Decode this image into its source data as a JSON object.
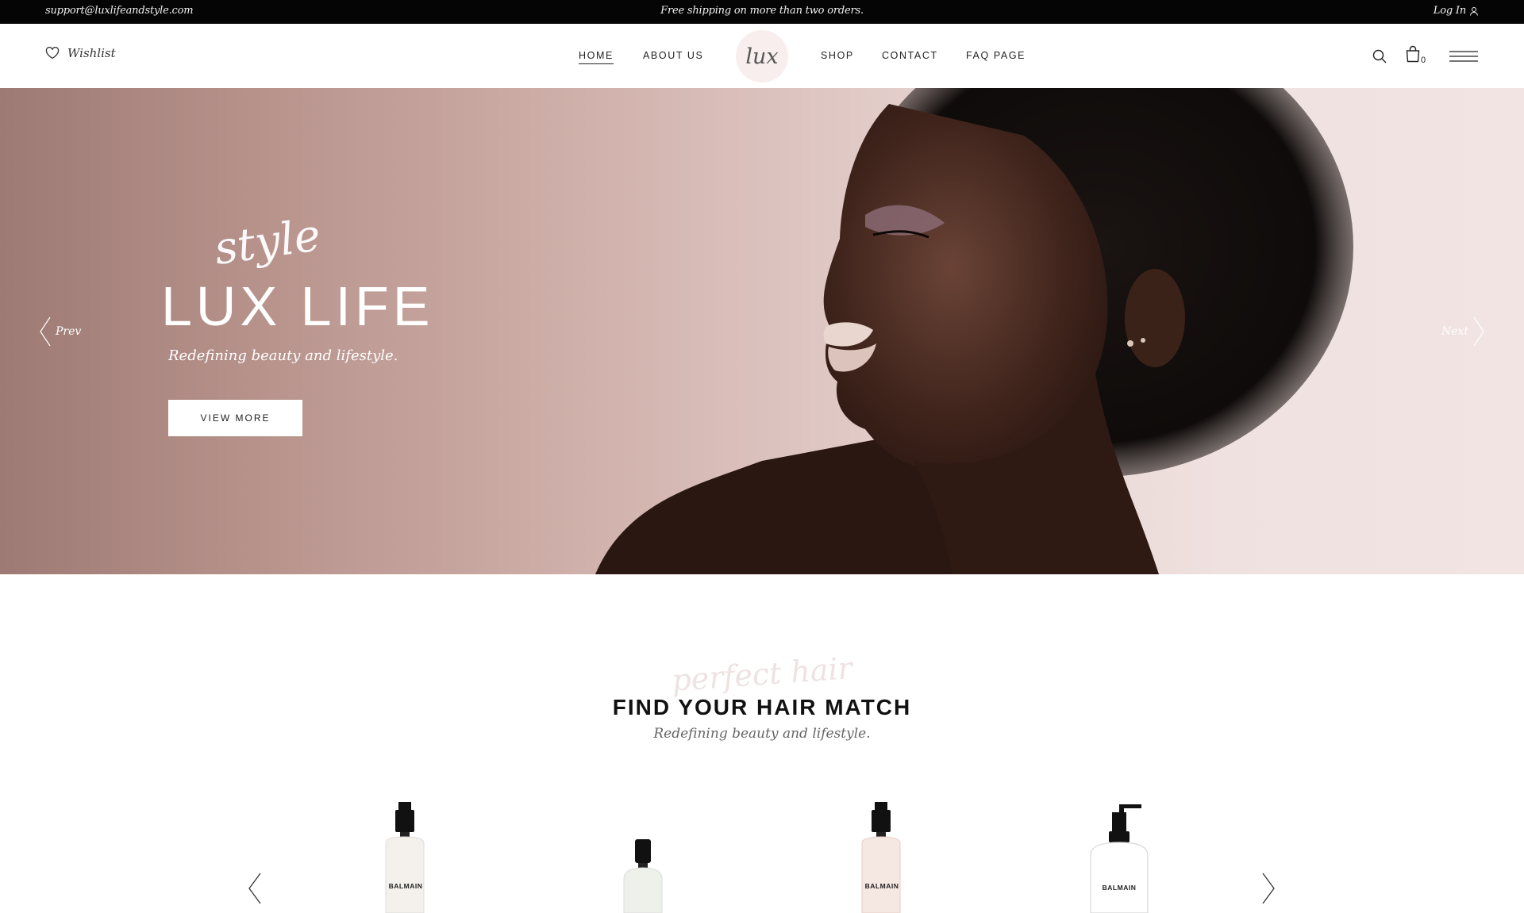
{
  "topbar": {
    "email": "support@luxlifeandstyle.com",
    "shipping": "Free shipping on more than two orders.",
    "login": "Log In"
  },
  "header": {
    "wishlist": "Wishlist",
    "nav": [
      "HOME",
      "ABOUT US",
      "SHOP",
      "CONTACT",
      "FAQ PAGE"
    ],
    "logo": "lux",
    "cart_count": "0"
  },
  "hero": {
    "script": "style",
    "title": "LUX LIFE",
    "subtitle": "Redefining beauty and lifestyle.",
    "button": "VIEW MORE",
    "prev": "Prev",
    "next": "Next"
  },
  "section": {
    "script": "perfect hair",
    "title": "FIND YOUR HAIR MATCH",
    "subtitle": "Redefining beauty and lifestyle."
  },
  "products": [
    {
      "brand": "BALMAIN"
    },
    {
      "brand": ""
    },
    {
      "brand": "BALMAIN"
    },
    {
      "brand": "BALMAIN"
    }
  ],
  "colors": {
    "topbar_bg": "#050505",
    "hero_bg": "#d0b0aa",
    "logo_bg": "#f9eeee"
  }
}
